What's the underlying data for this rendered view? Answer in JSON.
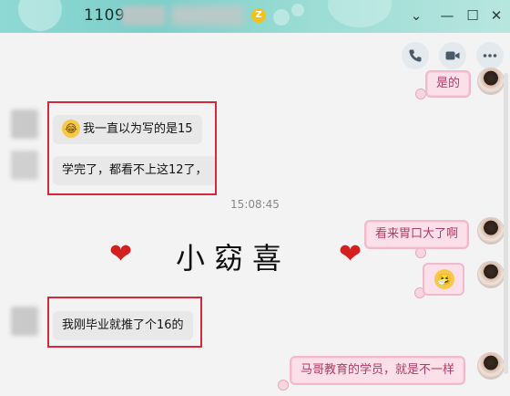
{
  "window": {
    "title_number": "1109",
    "crown_badge": "Z",
    "controls": {
      "menu": "⌄",
      "minimize": "—",
      "maximize": "☐",
      "close": "✕"
    }
  },
  "toolbar": {
    "icons": [
      "phone-icon",
      "video-icon",
      "more-icon"
    ]
  },
  "messages": {
    "right_1": "是的",
    "left_1_emoji": "😂",
    "left_1": "我一直以为写的是15",
    "left_2": "学完了，都看不上这12了，",
    "timestamp": "15:08:45",
    "right_2": "看来胃口大了啊",
    "right_3_emoji": "🤧",
    "left_3": "我刚毕业就推了个16的",
    "right_4": "马哥教育的学员，就是不一样"
  },
  "overlay": {
    "heart": "❤",
    "handwriting": "小窈喜"
  },
  "colors": {
    "titlebar": "#8fd9d3",
    "highlight_box": "#d6283a",
    "pink_bubble": "#fbe0ea",
    "pink_text": "#b33a62"
  }
}
